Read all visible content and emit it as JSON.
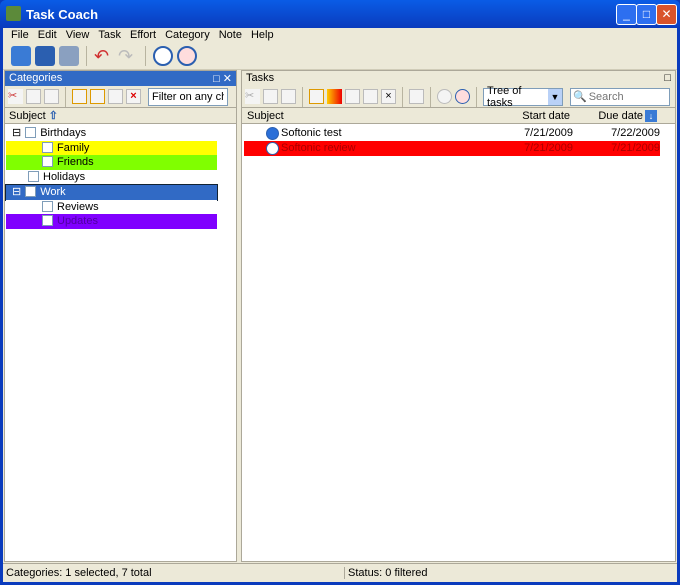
{
  "window": {
    "title": "Task Coach",
    "minimize": "_",
    "maximize": "□",
    "close": "✕"
  },
  "menu": [
    "File",
    "Edit",
    "View",
    "Task",
    "Effort",
    "Category",
    "Note",
    "Help"
  ],
  "categories": {
    "title": "Categories",
    "filter": "Filter on any checked category",
    "column": "Subject",
    "items": [
      {
        "label": "Birthdays",
        "color": "#ffffff",
        "level": 0,
        "expander": "⊟"
      },
      {
        "label": "Family",
        "color": "#ffff00",
        "level": 1
      },
      {
        "label": "Friends",
        "color": "#80ff00",
        "level": 1
      },
      {
        "label": "Holidays",
        "color": "#ffffff",
        "level": 0
      },
      {
        "label": "Work",
        "color": "#316ac5",
        "level": 0,
        "expander": "⊟",
        "selected": true
      },
      {
        "label": "Reviews",
        "color": "#ffffff",
        "level": 1
      },
      {
        "label": "Updates",
        "color": "#8000ff",
        "level": 1
      }
    ]
  },
  "tasks": {
    "title": "Tasks",
    "view": "Tree of tasks",
    "search_placeholder": "Search",
    "columns": {
      "subject": "Subject",
      "start": "Start date",
      "due": "Due date"
    },
    "rows": [
      {
        "subject": "Softonic test",
        "start": "7/21/2009",
        "due": "7/22/2009",
        "color": "#ffffff"
      },
      {
        "subject": "Softonic review",
        "start": "7/21/2009",
        "due": "7/21/2009",
        "color": "#ff0000"
      }
    ]
  },
  "status": {
    "left": "Categories: 1 selected, 7 total",
    "right": "Status: 0 filtered"
  }
}
